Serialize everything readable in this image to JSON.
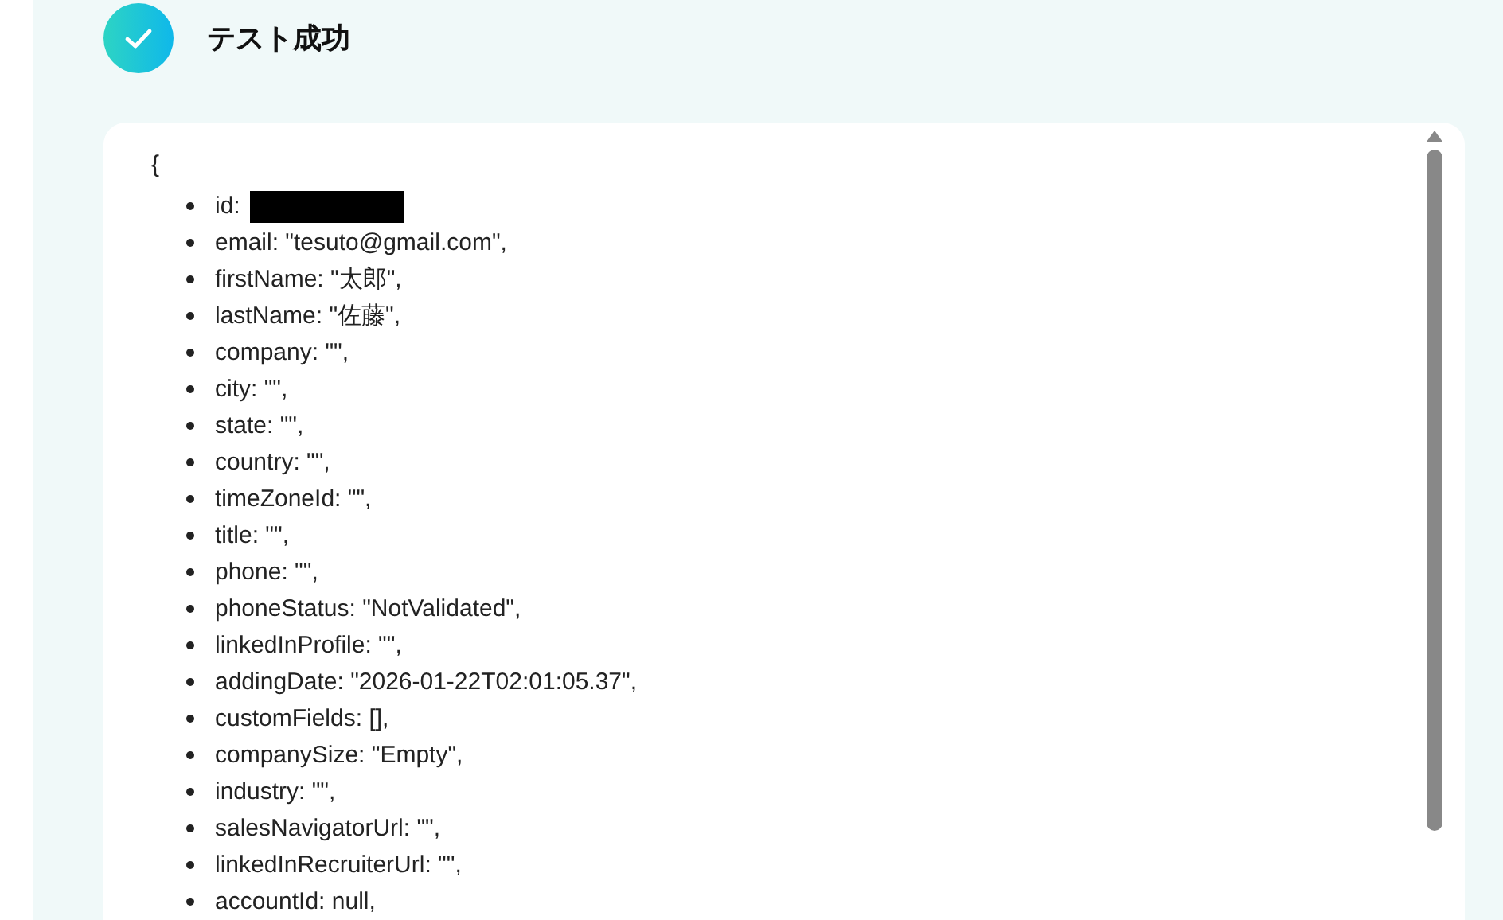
{
  "header": {
    "title": "テスト成功"
  },
  "output": {
    "open_brace": "{",
    "items": [
      {
        "text": "id:",
        "redacted": true
      },
      {
        "text": "email: \"tesuto@gmail.com\","
      },
      {
        "text": "firstName: \"太郎\","
      },
      {
        "text": "lastName: \"佐藤\","
      },
      {
        "text": "company: \"\","
      },
      {
        "text": "city: \"\","
      },
      {
        "text": "state: \"\","
      },
      {
        "text": "country: \"\","
      },
      {
        "text": "timeZoneId: \"\","
      },
      {
        "text": "title: \"\","
      },
      {
        "text": "phone: \"\","
      },
      {
        "text": "phoneStatus: \"NotValidated\","
      },
      {
        "text": "linkedInProfile: \"\","
      },
      {
        "text": "addingDate: \"2026-01-22T02:01:05.37\","
      },
      {
        "text": "customFields: [],"
      },
      {
        "text": "companySize: \"Empty\","
      },
      {
        "text": "industry: \"\","
      },
      {
        "text": "salesNavigatorUrl: \"\","
      },
      {
        "text": "linkedInRecruiterUrl: \"\","
      },
      {
        "text": "accountId: null,"
      }
    ]
  }
}
